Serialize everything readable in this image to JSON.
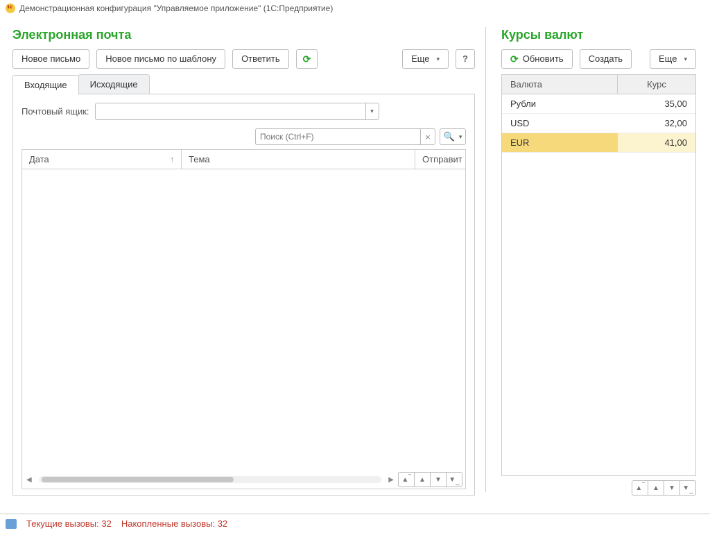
{
  "window": {
    "title": "Демонстрационная конфигурация \"Управляемое приложение\"  (1С:Предприятие)"
  },
  "email": {
    "title": "Электронная почта",
    "toolbar": {
      "new": "Новое письмо",
      "new_template": "Новое письмо по шаблону",
      "reply": "Ответить",
      "more": "Еще",
      "help": "?"
    },
    "tabs": {
      "inbox": "Входящие",
      "outbox": "Исходящие"
    },
    "mailbox_label": "Почтовый ящик:",
    "mailbox_value": "",
    "search_placeholder": "Поиск (Ctrl+F)",
    "columns": {
      "date": "Дата",
      "subject": "Тема",
      "sender": "Отправит"
    }
  },
  "rates": {
    "title": "Курсы валют",
    "toolbar": {
      "refresh": "Обновить",
      "create": "Создать",
      "more": "Еще"
    },
    "columns": {
      "currency": "Валюта",
      "rate": "Курс"
    },
    "rows": [
      {
        "currency": "Рубли",
        "rate": "35,00",
        "selected": false
      },
      {
        "currency": "USD",
        "rate": "32,00",
        "selected": false
      },
      {
        "currency": "EUR",
        "rate": "41,00",
        "selected": true
      }
    ]
  },
  "status": {
    "current_label": "Текущие вызовы:",
    "current_value": "32",
    "accum_label": "Накопленные вызовы:",
    "accum_value": "32"
  }
}
